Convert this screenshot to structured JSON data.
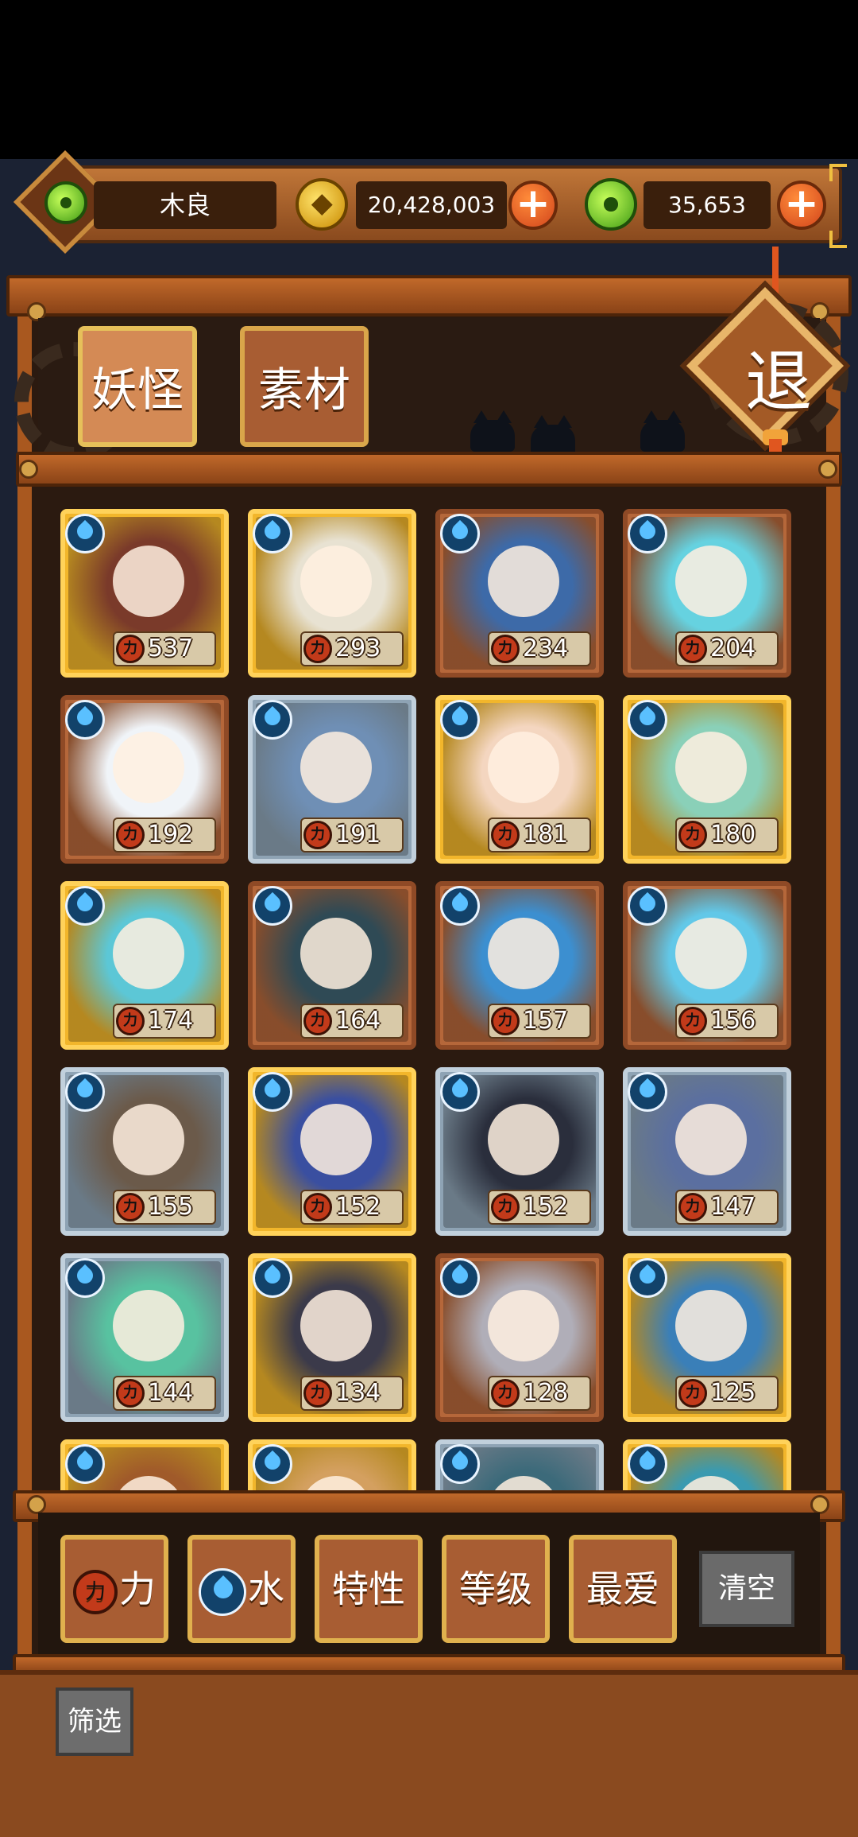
{
  "player": {
    "name": "木良"
  },
  "currency": {
    "gold": "20,428,003",
    "jade": "35,653"
  },
  "tabs": [
    {
      "label": "妖怪",
      "active": true
    },
    {
      "label": "素材",
      "active": false
    }
  ],
  "exit_label": "退",
  "power_glyph": "力",
  "cards": [
    {
      "power": "537",
      "rarity": "gold",
      "color": "#7a3a2a"
    },
    {
      "power": "293",
      "rarity": "gold",
      "color": "#e8e2d2"
    },
    {
      "power": "234",
      "rarity": "bronze",
      "color": "#3d6aa8"
    },
    {
      "power": "204",
      "rarity": "bronze",
      "color": "#66d2e0"
    },
    {
      "power": "192",
      "rarity": "bronze",
      "color": "#f0f4f8"
    },
    {
      "power": "191",
      "rarity": "silver",
      "color": "#6f8fb5"
    },
    {
      "power": "181",
      "rarity": "gold",
      "color": "#f4d6c0"
    },
    {
      "power": "180",
      "rarity": "gold",
      "color": "#8ad0b8"
    },
    {
      "power": "174",
      "rarity": "gold",
      "color": "#5cc7d6"
    },
    {
      "power": "164",
      "rarity": "bronze",
      "color": "#2f4a55"
    },
    {
      "power": "157",
      "rarity": "bronze",
      "color": "#3c8fd0"
    },
    {
      "power": "156",
      "rarity": "bronze",
      "color": "#62c8e8"
    },
    {
      "power": "155",
      "rarity": "silver",
      "color": "#6b5a4a"
    },
    {
      "power": "152",
      "rarity": "gold",
      "color": "#3a4fa0"
    },
    {
      "power": "152",
      "rarity": "silver",
      "color": "#2a2e3c"
    },
    {
      "power": "147",
      "rarity": "silver",
      "color": "#5b6fa0"
    },
    {
      "power": "144",
      "rarity": "silver",
      "color": "#58c2a0"
    },
    {
      "power": "134",
      "rarity": "gold",
      "color": "#3b3a4a"
    },
    {
      "power": "128",
      "rarity": "bronze",
      "color": "#b0aeb8"
    },
    {
      "power": "125",
      "rarity": "gold",
      "color": "#3a7fb8"
    },
    {
      "power": "",
      "rarity": "gold",
      "color": "#a05a2a"
    },
    {
      "power": "",
      "rarity": "gold",
      "color": "#d4a060"
    },
    {
      "power": "",
      "rarity": "silver",
      "color": "#3c6a7a"
    },
    {
      "power": "",
      "rarity": "gold",
      "color": "#3a9ab0"
    }
  ],
  "filters": [
    {
      "label": "力",
      "icon": "power-icon"
    },
    {
      "label": "水",
      "icon": "water-icon"
    },
    {
      "label": "特性",
      "icon": ""
    },
    {
      "label": "等级",
      "icon": ""
    },
    {
      "label": "最爱",
      "icon": ""
    }
  ],
  "clear_label": "清空",
  "screen_label": "筛选"
}
